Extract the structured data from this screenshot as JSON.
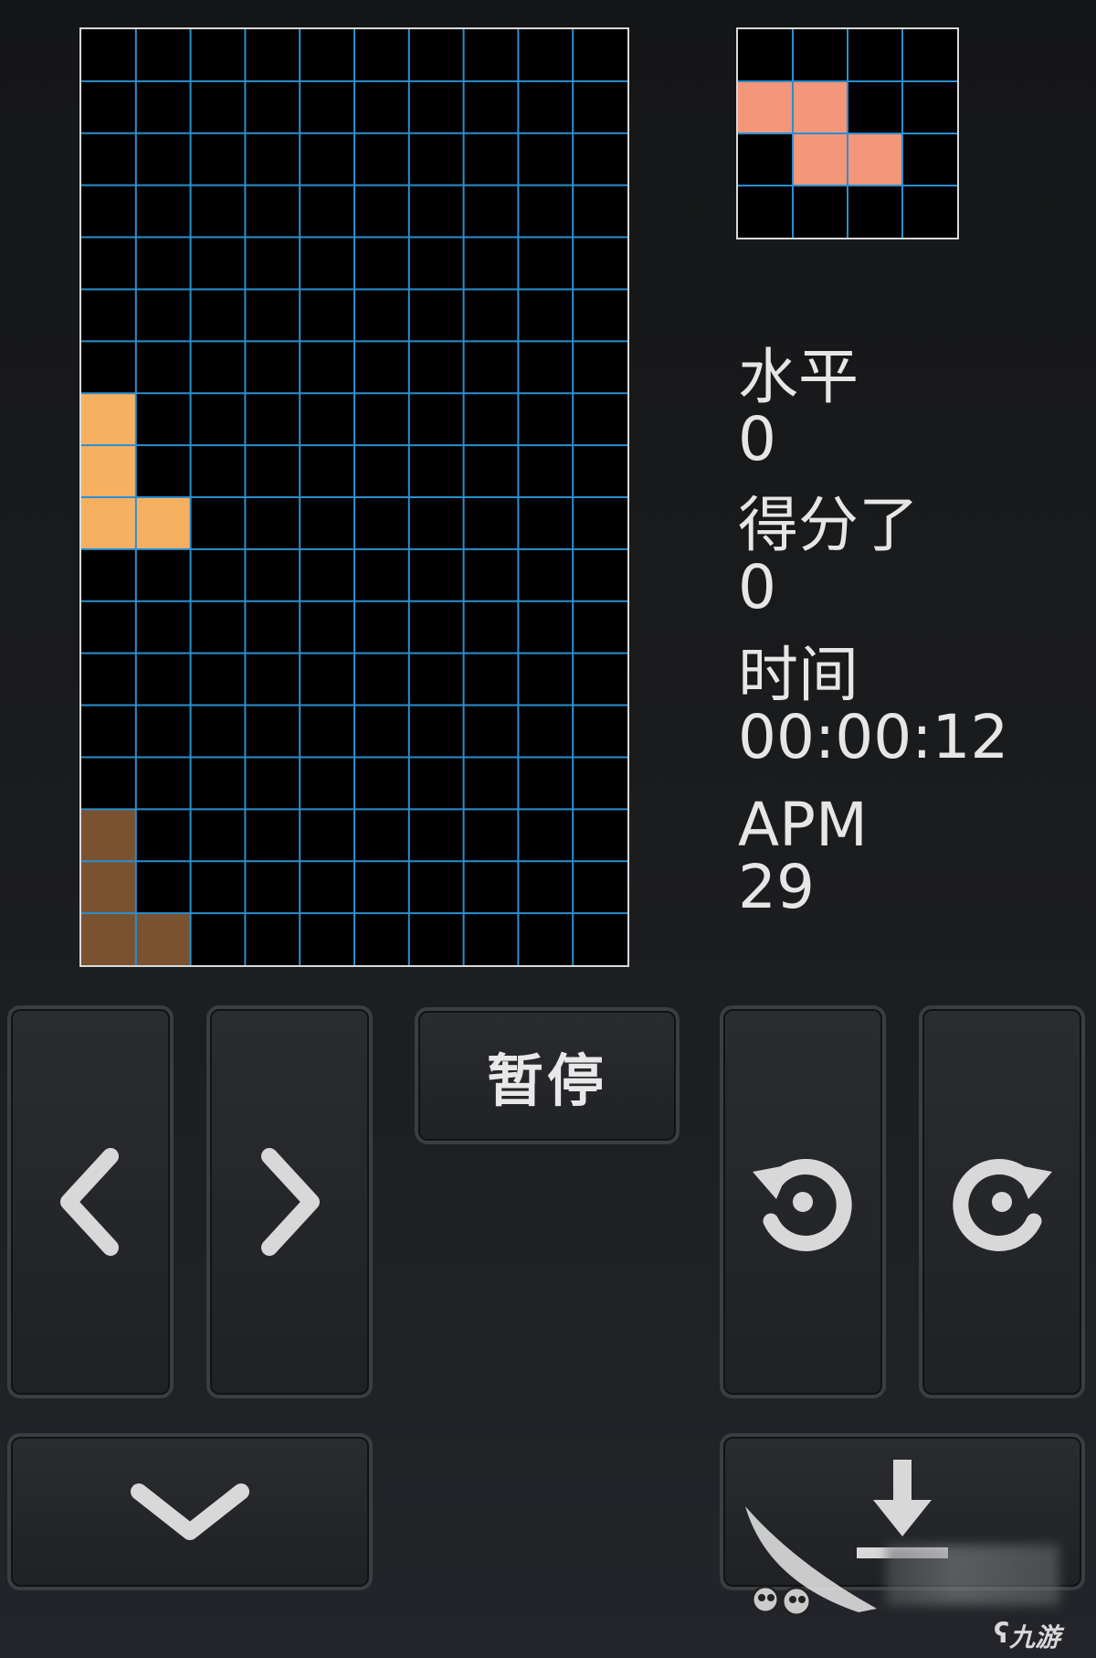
{
  "board": {
    "cols": 10,
    "rows": 18,
    "grid_color": "#2a8fd0",
    "border_color": "#d9d9d9",
    "cells": [
      {
        "col": 0,
        "row": 7,
        "color": "#f7b062",
        "kind": "falling"
      },
      {
        "col": 0,
        "row": 8,
        "color": "#f7b062",
        "kind": "falling"
      },
      {
        "col": 0,
        "row": 9,
        "color": "#f7b062",
        "kind": "falling"
      },
      {
        "col": 1,
        "row": 9,
        "color": "#f7b062",
        "kind": "falling"
      },
      {
        "col": 0,
        "row": 15,
        "color": "#7a5230",
        "kind": "ghost"
      },
      {
        "col": 0,
        "row": 16,
        "color": "#7a5230",
        "kind": "ghost"
      },
      {
        "col": 0,
        "row": 17,
        "color": "#7a5230",
        "kind": "ghost"
      },
      {
        "col": 1,
        "row": 17,
        "color": "#7a5230",
        "kind": "ghost"
      }
    ]
  },
  "next_piece": {
    "cols": 4,
    "rows": 4,
    "grid_color": "#2a8fd0",
    "cells": [
      {
        "col": 0,
        "row": 1,
        "color": "#f3967a"
      },
      {
        "col": 1,
        "row": 1,
        "color": "#f3967a"
      },
      {
        "col": 1,
        "row": 2,
        "color": "#f3967a"
      },
      {
        "col": 2,
        "row": 2,
        "color": "#f3967a"
      }
    ]
  },
  "stats": {
    "level_label": "水平",
    "level_value": "0",
    "score_label": "得分了",
    "score_value": "0",
    "time_label": "时间",
    "time_value": "00:00:12",
    "apm_label": "APM",
    "apm_value": "29"
  },
  "controls": {
    "pause_label": "暂停",
    "left_icon": "chevron-left-icon",
    "right_icon": "chevron-right-icon",
    "rotate_ccw_icon": "rotate-ccw-icon",
    "rotate_cw_icon": "rotate-cw-icon",
    "soft_drop_icon": "chevron-down-icon",
    "hard_drop_icon": "hard-drop-icon"
  },
  "branding": {
    "logo_text": "九游"
  }
}
